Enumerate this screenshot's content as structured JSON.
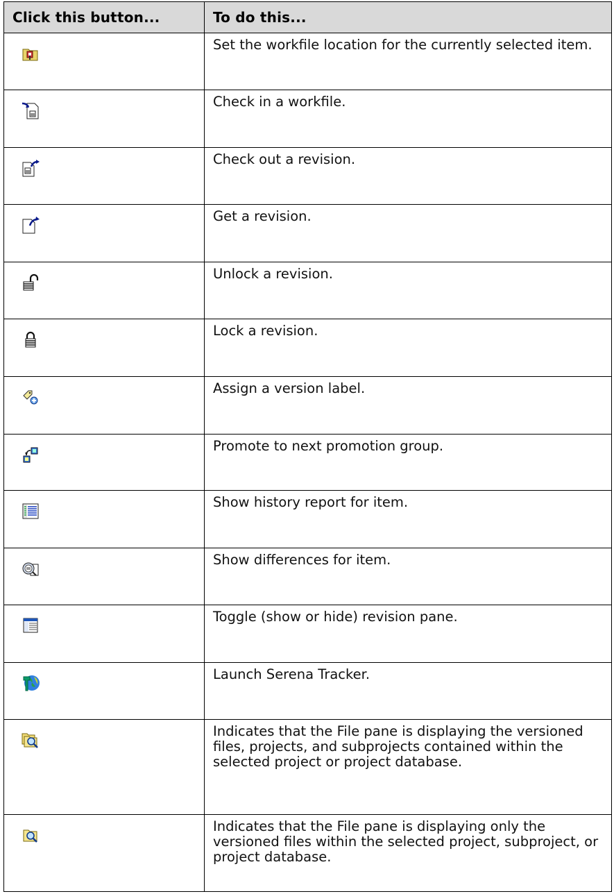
{
  "header": {
    "col1": "Click this button...",
    "col2": "To do this..."
  },
  "rows": [
    {
      "icon": "workfile-location-icon",
      "desc": "Set the workfile location for the currently selected item."
    },
    {
      "icon": "check-in-icon",
      "desc": "Check in a workfile."
    },
    {
      "icon": "check-out-icon",
      "desc": "Check out a revision."
    },
    {
      "icon": "get-revision-icon",
      "desc": "Get a revision."
    },
    {
      "icon": "unlock-icon",
      "desc": "Unlock a revision."
    },
    {
      "icon": "lock-icon",
      "desc": "Lock a revision."
    },
    {
      "icon": "version-label-icon",
      "desc": "Assign a version label."
    },
    {
      "icon": "promote-icon",
      "desc": "Promote to next promotion group."
    },
    {
      "icon": "history-report-icon",
      "desc": "Show history report for item."
    },
    {
      "icon": "differences-icon",
      "desc": "Show differences for item."
    },
    {
      "icon": "revision-pane-icon",
      "desc": "Toggle (show or hide) revision pane."
    },
    {
      "icon": "serena-tracker-icon",
      "desc": "Launch Serena Tracker."
    },
    {
      "icon": "show-all-files-icon",
      "desc": "Indicates that the File pane is displaying the versioned files, projects, and subprojects contained within the selected project or project database."
    },
    {
      "icon": "show-files-only-icon",
      "desc": "Indicates that the File pane is displaying only the versioned files within the selected project, subproject, or project database."
    }
  ]
}
